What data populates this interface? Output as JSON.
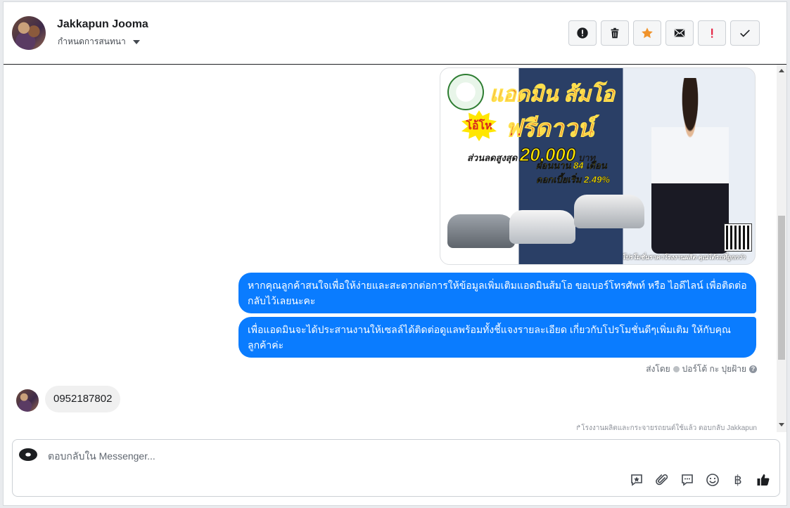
{
  "header": {
    "contact_name": "Jakkapun Jooma",
    "assign_label": "กำหนดการสนทนา",
    "actions": [
      {
        "name": "spam",
        "icon": "alert-circle-icon"
      },
      {
        "name": "delete",
        "icon": "trash-icon"
      },
      {
        "name": "star",
        "icon": "star-icon",
        "color": "#f0932b"
      },
      {
        "name": "mark-unread",
        "icon": "envelope-icon"
      },
      {
        "name": "important",
        "icon": "exclamation-icon",
        "color": "#e41e3f"
      },
      {
        "name": "done",
        "icon": "check-icon"
      }
    ]
  },
  "promo_image": {
    "headline": "แอดมิน ส้มโอ",
    "badge": "โอ้โห",
    "free_down": "ฟรีดาวน์",
    "discount_prefix": "ส่วนลดสูงสุด",
    "discount_amount": "20,000",
    "discount_unit": "บาท",
    "installment": "ผ่อนนาน 84 เดือน",
    "interest": "ดอกเบี้ยเริ่ม 2.49%",
    "footer": "โปรโมชั่นราคาโรงงานผลิต คุณได้รถที่ถูกกว่า"
  },
  "messages": {
    "outgoing_1": "หากคุณลูกค้าสนใจเพื่อให้ง่ายและสะดวกต่อการให้ข้อมูลเพิ่มเติมแอดมินส้มโอ ขอเบอร์โทรศัพท์ หรือ ไอดีไลน์ เพื่อติดต่อกลับไว้เลยนะคะ",
    "outgoing_2": "เพื่อแอดมินจะได้ประสานงานให้เซลล์ได้ติดต่อดูแลพร้อมทั้งชี้แจงรายละเอียด เกี่ยวกับโปรโมชั่นดีๆเพิ่มเติม ให้กับคุณลูกค้าค่ะ",
    "sent_by_label": "ส่งโดย",
    "sent_by_name": "ปอร์โต้ กะ ปุยฝ้าย",
    "incoming_1": "0952187802",
    "reply_note": "↱โรงงานผลิตและกระจายรถยนต์ใช้แล้ว ตอบกลับ Jakkapun"
  },
  "composer": {
    "placeholder": "ตอบกลับใน Messenger...",
    "tools": [
      "saved-reply-icon",
      "attachment-icon",
      "chat-bubble-icon",
      "emoji-icon",
      "baht-icon",
      "thumbs-up-icon"
    ],
    "currency_symbol": "฿"
  },
  "colors": {
    "bubble_blue": "#0a7cff",
    "star_orange": "#f0932b",
    "important_red": "#e41e3f"
  }
}
